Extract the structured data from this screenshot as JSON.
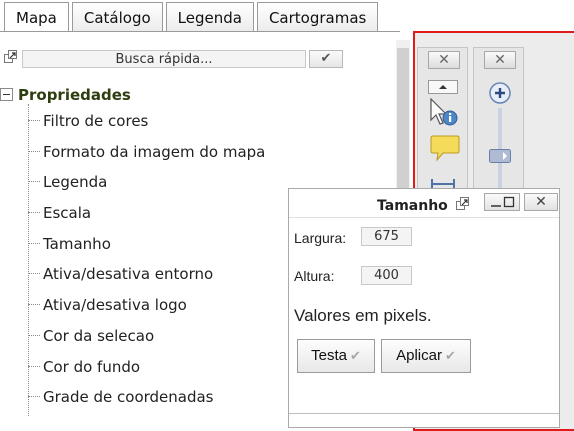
{
  "tabs": [
    {
      "label": "Mapa"
    },
    {
      "label": "Catálogo"
    },
    {
      "label": "Legenda"
    },
    {
      "label": "Cartogramas"
    }
  ],
  "quick_search": {
    "value": "Busca rápida...",
    "button_glyph": "✔",
    "popout_icon": "popout-icon"
  },
  "tree": {
    "title": "Propriedades",
    "toggle_glyph": "−",
    "items": [
      {
        "label": "Filtro de cores"
      },
      {
        "label": "Formato da imagem do mapa"
      },
      {
        "label": "Legenda"
      },
      {
        "label": "Escala"
      },
      {
        "label": "Tamanho"
      },
      {
        "label": "Ativa/desativa entorno"
      },
      {
        "label": "Ativa/desativa logo"
      },
      {
        "label": "Cor da selecao"
      },
      {
        "label": "Cor do fundo"
      },
      {
        "label": "Grade de coordenadas"
      }
    ]
  },
  "map_toolbars": {
    "close_glyph": "✕",
    "icons": [
      "scroll-up-icon",
      "info-cursor-icon",
      "comment-balloon-icon",
      "measure-icon",
      "zoom-in-icon",
      "zoom-slider-icon"
    ]
  },
  "dialog": {
    "title": "Tamanho",
    "minimize_glyph": "▁▢",
    "close_glyph": "✕",
    "fields": {
      "width_label": "Largura:",
      "width_value": "675",
      "height_label": "Altura:",
      "height_value": "400"
    },
    "note": "Valores em pixels.",
    "buttons": {
      "test_label": "Testa",
      "apply_label": "Aplicar",
      "check_glyph": "✔"
    }
  },
  "colors": {
    "map_border": "#e01b1b",
    "tree_title": "#2e3d10"
  }
}
